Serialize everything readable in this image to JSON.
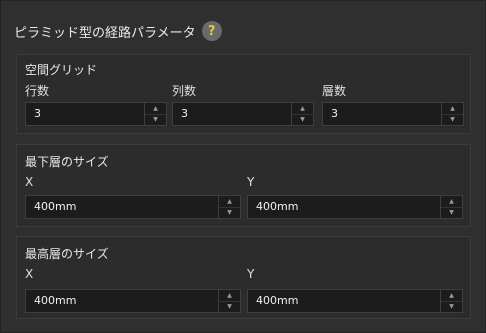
{
  "header": {
    "title": "ピラミッド型の経路パラメータ",
    "help_glyph": "?"
  },
  "grid_group": {
    "title": "空間グリッド",
    "fields": [
      {
        "label": "行数",
        "value": "3"
      },
      {
        "label": "列数",
        "value": "3"
      },
      {
        "label": "層数",
        "value": "3"
      }
    ]
  },
  "bottom_group": {
    "title": "最下層のサイズ",
    "fields": [
      {
        "label": "X",
        "value": "400mm"
      },
      {
        "label": "Y",
        "value": "400mm"
      }
    ]
  },
  "top_group": {
    "title": "最高層のサイズ",
    "fields": [
      {
        "label": "X",
        "value": "400mm"
      },
      {
        "label": "Y",
        "value": "400mm"
      }
    ]
  },
  "icons": {
    "spin_up": "triangle-up",
    "spin_down": "triangle-down",
    "help": "question-mark"
  }
}
